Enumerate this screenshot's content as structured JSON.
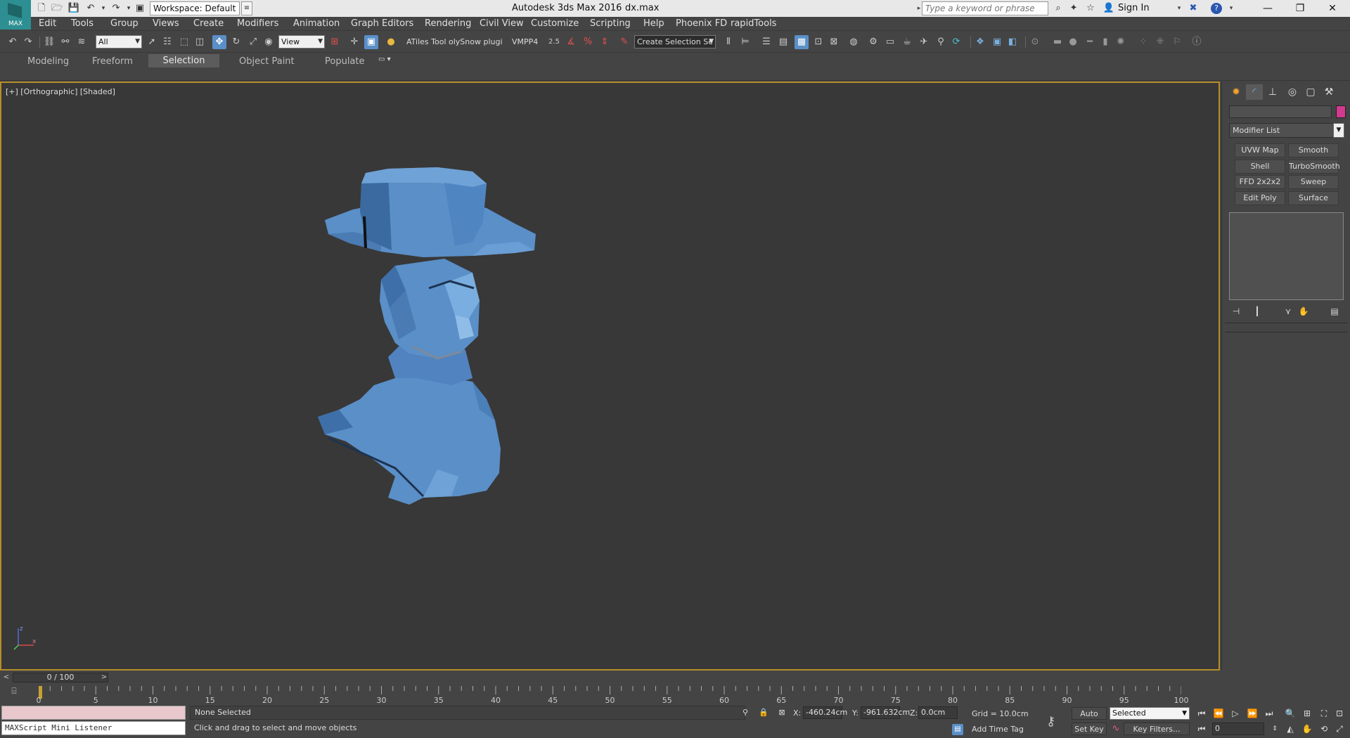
{
  "titlebar": {
    "logo_text": "MAX",
    "workspace": "Workspace: Default",
    "app_title": "Autodesk 3ds Max 2016",
    "file_name": "dx.max",
    "search_placeholder": "Type a keyword or phrase",
    "sign_in": "Sign In"
  },
  "menu": [
    "Edit",
    "Tools",
    "Group",
    "Views",
    "Create",
    "Modifiers",
    "Animation",
    "Graph Editors",
    "Rendering",
    "Civil View",
    "Customize",
    "Scripting",
    "Help",
    "Phoenix FD",
    "rapidTools"
  ],
  "toolbar": {
    "filter": "All",
    "ref_coord": "View",
    "atiles": "ATiles Tool",
    "polysnow": "olySnow plugi",
    "vmpp": "VMPP4",
    "angle_snap": "2.5",
    "selection_set": "Create Selection Se"
  },
  "ribbon": {
    "tabs": [
      "Modeling",
      "Freeform",
      "Selection",
      "Object Paint",
      "Populate"
    ]
  },
  "viewport": {
    "label": "[+] [Orthographic] [Shaded]",
    "model_color": "#5a8fc8",
    "border_color": "#b58e2a",
    "axis": {
      "z": "z",
      "x": "x"
    }
  },
  "command_panel": {
    "modifier_list": "Modifier List",
    "object_color": "#d33a8f",
    "modifier_buttons": [
      "UVW Map",
      "Smooth",
      "Shell",
      "TurboSmooth",
      "FFD 2x2x2",
      "Sweep",
      "Edit Poly",
      "Surface"
    ]
  },
  "timeline": {
    "frame_display": "0 / 100",
    "ticks": [
      "0",
      "5",
      "10",
      "15",
      "20",
      "25",
      "30",
      "35",
      "40",
      "45",
      "50",
      "55",
      "60",
      "65",
      "70",
      "75",
      "80",
      "85",
      "90",
      "95",
      "100"
    ]
  },
  "status": {
    "maxscript": "MAXScript Mini Listener",
    "selection": "None Selected",
    "prompt": "Click and drag to select and move objects",
    "x_label": "X:",
    "x_value": "-460.24cm",
    "y_label": "Y:",
    "y_value": "-961.632cm",
    "z_label": "Z:",
    "z_value": "0.0cm",
    "grid": "Grid = 10.0cm",
    "add_time_tag": "Add Time Tag",
    "auto_key": "Auto Key",
    "set_key": "Set Key",
    "key_mode": "Selected",
    "key_filters": "Key Filters...",
    "current_frame": "0"
  }
}
